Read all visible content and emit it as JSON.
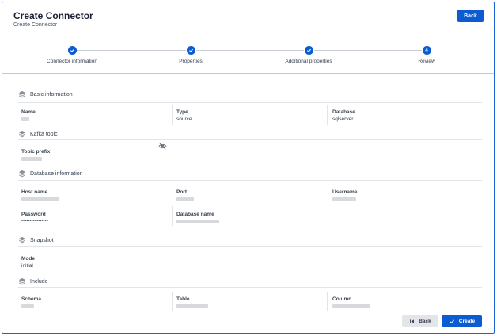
{
  "header": {
    "title": "Create Connector",
    "subtitle": "Create Connector",
    "back_label": "Back"
  },
  "stepper": {
    "steps": [
      {
        "label": "Connector information",
        "state": "done",
        "icon": "check-icon"
      },
      {
        "label": "Properties",
        "state": "done",
        "icon": "check-icon"
      },
      {
        "label": "Additional properties",
        "state": "done",
        "icon": "check-icon"
      },
      {
        "label": "Review",
        "state": "current",
        "number": "4"
      }
    ]
  },
  "sections": {
    "basic": {
      "title": "Basic information",
      "name_label": "Name",
      "type_label": "Type",
      "type_value": "source",
      "database_label": "Database",
      "database_value": "sqlserver"
    },
    "kafka": {
      "title": "Kafka topic",
      "topic_prefix_label": "Topic prefix"
    },
    "database": {
      "title": "Database information",
      "host_label": "Host name",
      "port_label": "Port",
      "username_label": "Username",
      "password_label": "Password",
      "password_value": "••••••••••••••••",
      "dbname_label": "Database name"
    },
    "snapshot": {
      "title": "Snapshot",
      "mode_label": "Mode",
      "mode_value": "initial"
    },
    "include": {
      "title": "Include",
      "schema_label": "Schema",
      "table_label": "Table",
      "column_label": "Column"
    }
  },
  "footer": {
    "back_label": "Back",
    "create_label": "Create"
  },
  "colors": {
    "primary": "#0b5bd3",
    "border": "#1e63d6",
    "placeholder": "#d7d9dd"
  }
}
